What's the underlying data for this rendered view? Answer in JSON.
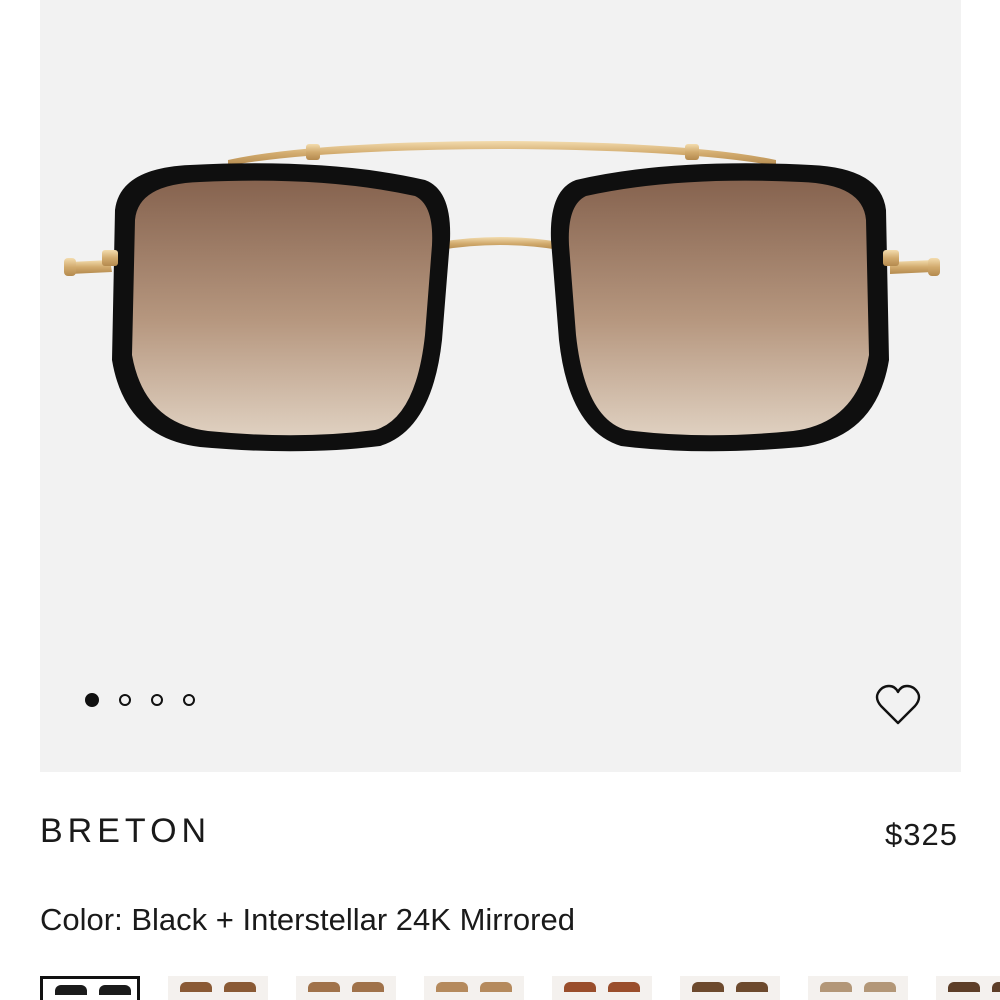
{
  "product": {
    "name": "BRETON",
    "price": "$325",
    "color_label": "Color:",
    "color_value": "Black + Interstellar 24K Mirrored"
  },
  "gallery": {
    "slide_count": 4,
    "active_slide": 1,
    "wishlist_icon": "heart-outline-icon"
  },
  "swatches": [
    {
      "name": "black-interstellar",
      "color": "#1b1b1b",
      "selected": true
    },
    {
      "name": "tortoise-1",
      "color": "#8a5a35",
      "selected": false
    },
    {
      "name": "tortoise-2",
      "color": "#a0724a",
      "selected": false
    },
    {
      "name": "tortoise-3",
      "color": "#b58a5d",
      "selected": false
    },
    {
      "name": "tortoise-4",
      "color": "#9a4e2c",
      "selected": false
    },
    {
      "name": "tortoise-5",
      "color": "#6d4a2e",
      "selected": false
    },
    {
      "name": "tortoise-6",
      "color": "#b39778",
      "selected": false
    },
    {
      "name": "tortoise-7",
      "color": "#5d3e28",
      "selected": false
    }
  ],
  "colors": {
    "gallery_bg": "#f2f2f2",
    "frame": "#111111",
    "metal": "#d9b57a",
    "lens_top": "#8b6a55",
    "lens_bottom": "#d8c7b6"
  }
}
